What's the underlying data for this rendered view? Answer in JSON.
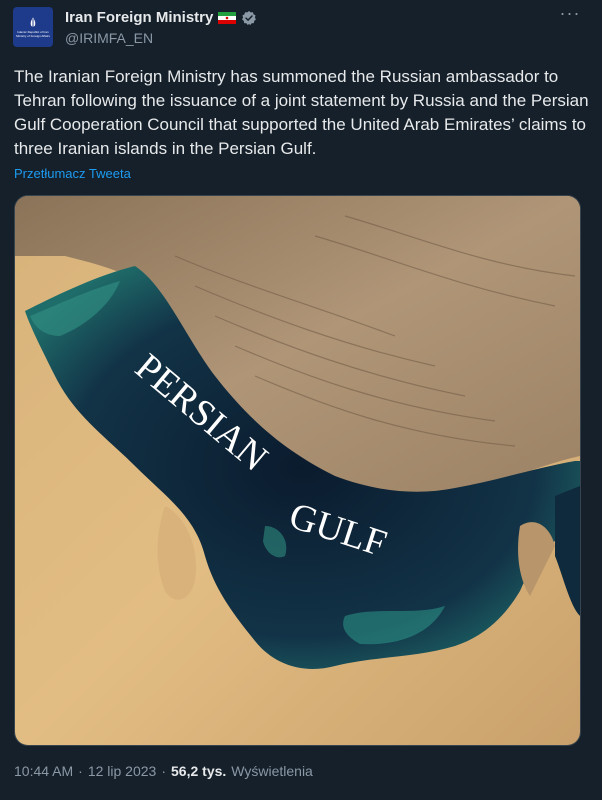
{
  "author": {
    "display_name": "Iran Foreign Ministry",
    "handle": "@IRIMFA_EN",
    "avatar_caption": "Islamic Republic of Iran Ministry of Foreign Affairs",
    "flag_icon": "iran-flag-icon",
    "verified_icon": "verified-badge-icon"
  },
  "tweet": {
    "text": "The Iranian Foreign Ministry has summoned the Russian ambassador to Tehran following the issuance of a joint statement by Russia and the Persian Gulf Cooperation Council that supported the United Arab Emirates’ claims to three Iranian islands in the Persian Gulf.",
    "translate_label": "Przetłumacz Tweeta",
    "more_label": "···"
  },
  "media": {
    "map_label_line1": "PERSIAN",
    "map_label_line2": "GULF"
  },
  "meta": {
    "time": "10:44 AM",
    "date": "12 lip 2023",
    "separator": "·",
    "views_count": "56,2 tys.",
    "views_label": "Wyświetlenia"
  },
  "colors": {
    "background": "#15202b",
    "text": "#e7e9ea",
    "secondary": "#8b98a5",
    "link": "#1d9bf0",
    "verified": "#8b98a5"
  }
}
